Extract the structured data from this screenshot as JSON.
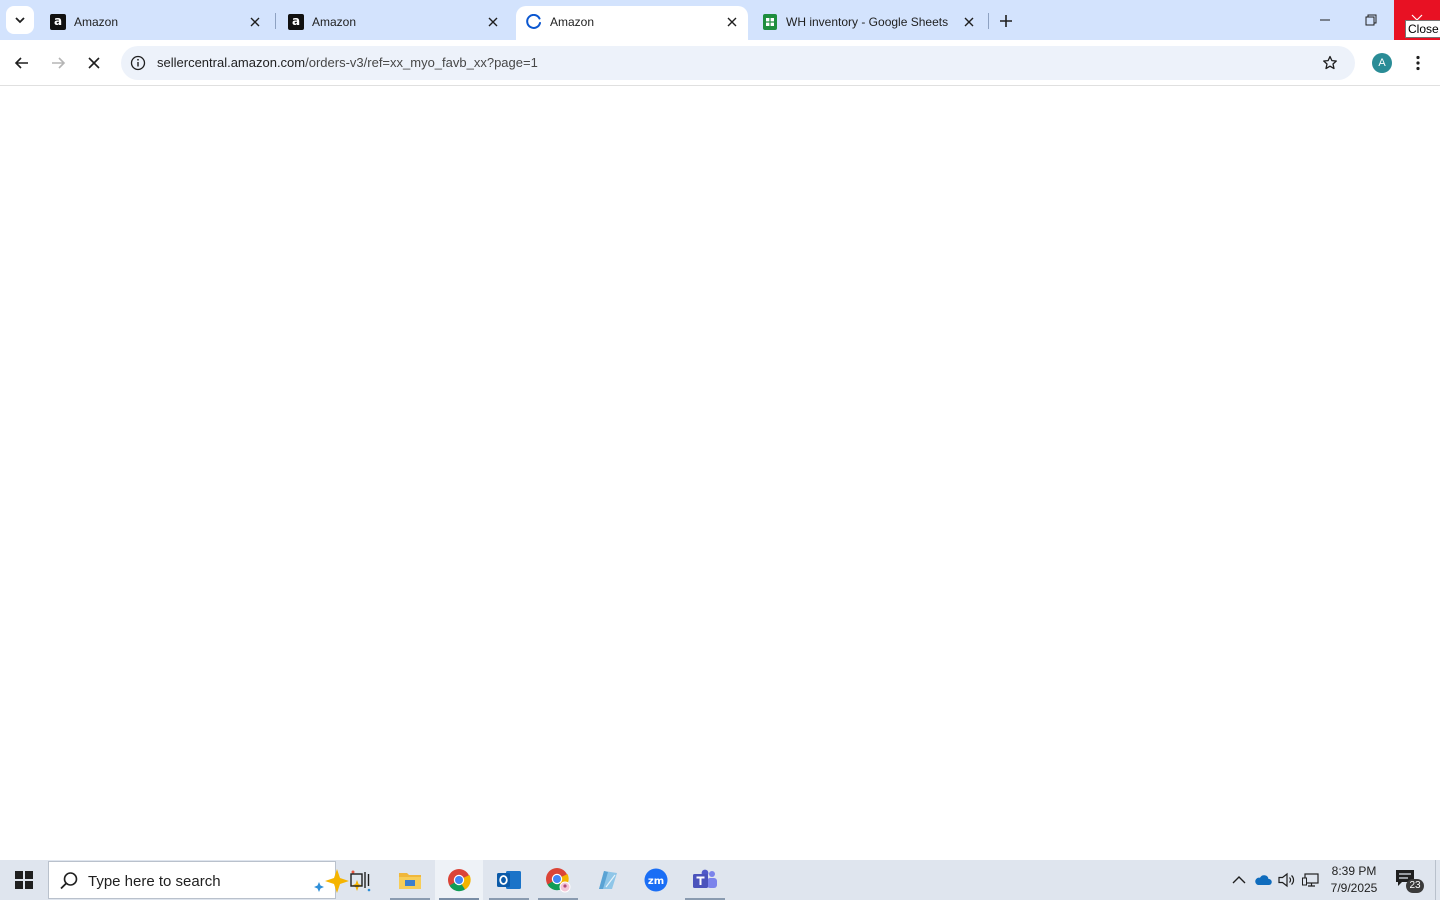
{
  "browser": {
    "tabs": [
      {
        "title": "Amazon",
        "favicon": "amazon-logo-icon",
        "active": false
      },
      {
        "title": "Amazon",
        "favicon": "amazon-logo-icon",
        "active": false
      },
      {
        "title": "Amazon",
        "favicon": "loading-spinner-icon",
        "active": true
      },
      {
        "title": "WH inventory - Google Sheets",
        "favicon": "google-sheets-icon",
        "active": false
      }
    ],
    "close_tooltip": "Close",
    "omnibox": {
      "domain": "sellercentral.amazon.com",
      "path": "/orders-v3/ref=xx_myo_favb_xx?page=1"
    },
    "profile_initial": "A",
    "colors": {
      "tabstrip": "#d3e3fd",
      "omnibox": "#edf2fa",
      "close": "#e81123",
      "avatar": "#2a8c96"
    }
  },
  "taskbar": {
    "search_placeholder": "Type here to search",
    "apps": [
      "task-view-icon",
      "file-explorer-icon",
      "chrome-icon",
      "outlook-icon",
      "chrome-profile-icon",
      "edge-like-app-icon",
      "zoom-icon",
      "teams-icon"
    ],
    "time": "8:39 PM",
    "date": "7/9/2025",
    "notification_count": "23"
  }
}
